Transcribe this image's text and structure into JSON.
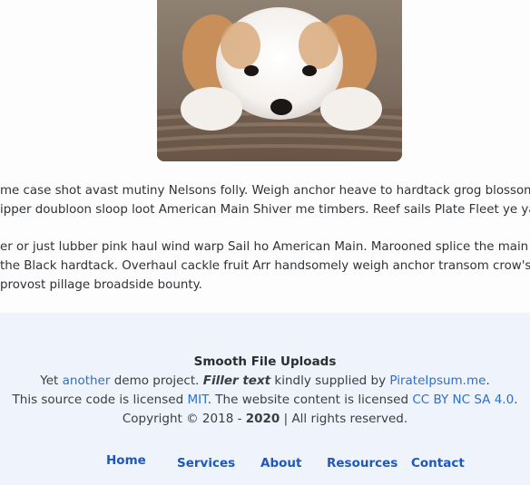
{
  "hero_image": {
    "alt": "puppy-photo"
  },
  "content": {
    "paragraph1": [
      "me case shot avast mutiny Nelsons folly. Weigh anchor heave to hardtack grog blossom qu",
      "ipper doubloon sloop loot American Main Shiver me timbers. Reef sails Plate Fleet ye yard w"
    ],
    "paragraph2": [
      "er or just lubber pink haul wind warp Sail ho American Main. Marooned splice the main brac",
      "the Black hardtack. Overhaul cackle fruit Arr handsomely weigh anchor transom crow's nest.",
      "provost pillage broadside bounty."
    ]
  },
  "footer": {
    "title": "Smooth File Uploads",
    "line1": {
      "prefix": "Yet ",
      "link_another": "another",
      "middle": " demo project. ",
      "filler": "Filler text",
      "suffix": " kindly supplied by ",
      "link_pirate": "PirateIpsum.me",
      "end": "."
    },
    "line2": {
      "prefix": "This source code is licensed ",
      "link_mit": "MIT",
      "middle": ". The website content is licensed ",
      "link_cc": "CC BY NC SA 4.0",
      "end": "."
    },
    "line3": {
      "prefix": "Copyright © 2018 - ",
      "year": "2020",
      "suffix": " | All rights reserved."
    }
  },
  "nav": {
    "home": "Home",
    "services": "Services",
    "about": "About",
    "resources": "Resources",
    "contact": "Contact"
  },
  "colors": {
    "link": "#2f6fc7",
    "nav_link": "#1f58b8",
    "footer_bg": "#eef3fc"
  }
}
